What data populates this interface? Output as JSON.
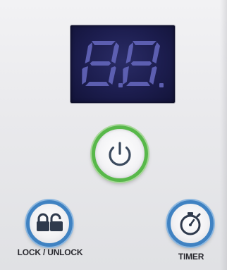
{
  "display": {
    "readout": "8.8."
  },
  "buttons": {
    "power": {
      "icon": "power-icon"
    },
    "lock": {
      "icon": "padlock-icon",
      "label": "LOCK / UNLOCK"
    },
    "timer": {
      "icon": "stopwatch-icon",
      "label": "TIMER"
    }
  },
  "colors": {
    "power_ring": "#58b84a",
    "button_ring": "#3f82c2",
    "display_background": "#1c1d4e",
    "segment": "#6264b8"
  }
}
